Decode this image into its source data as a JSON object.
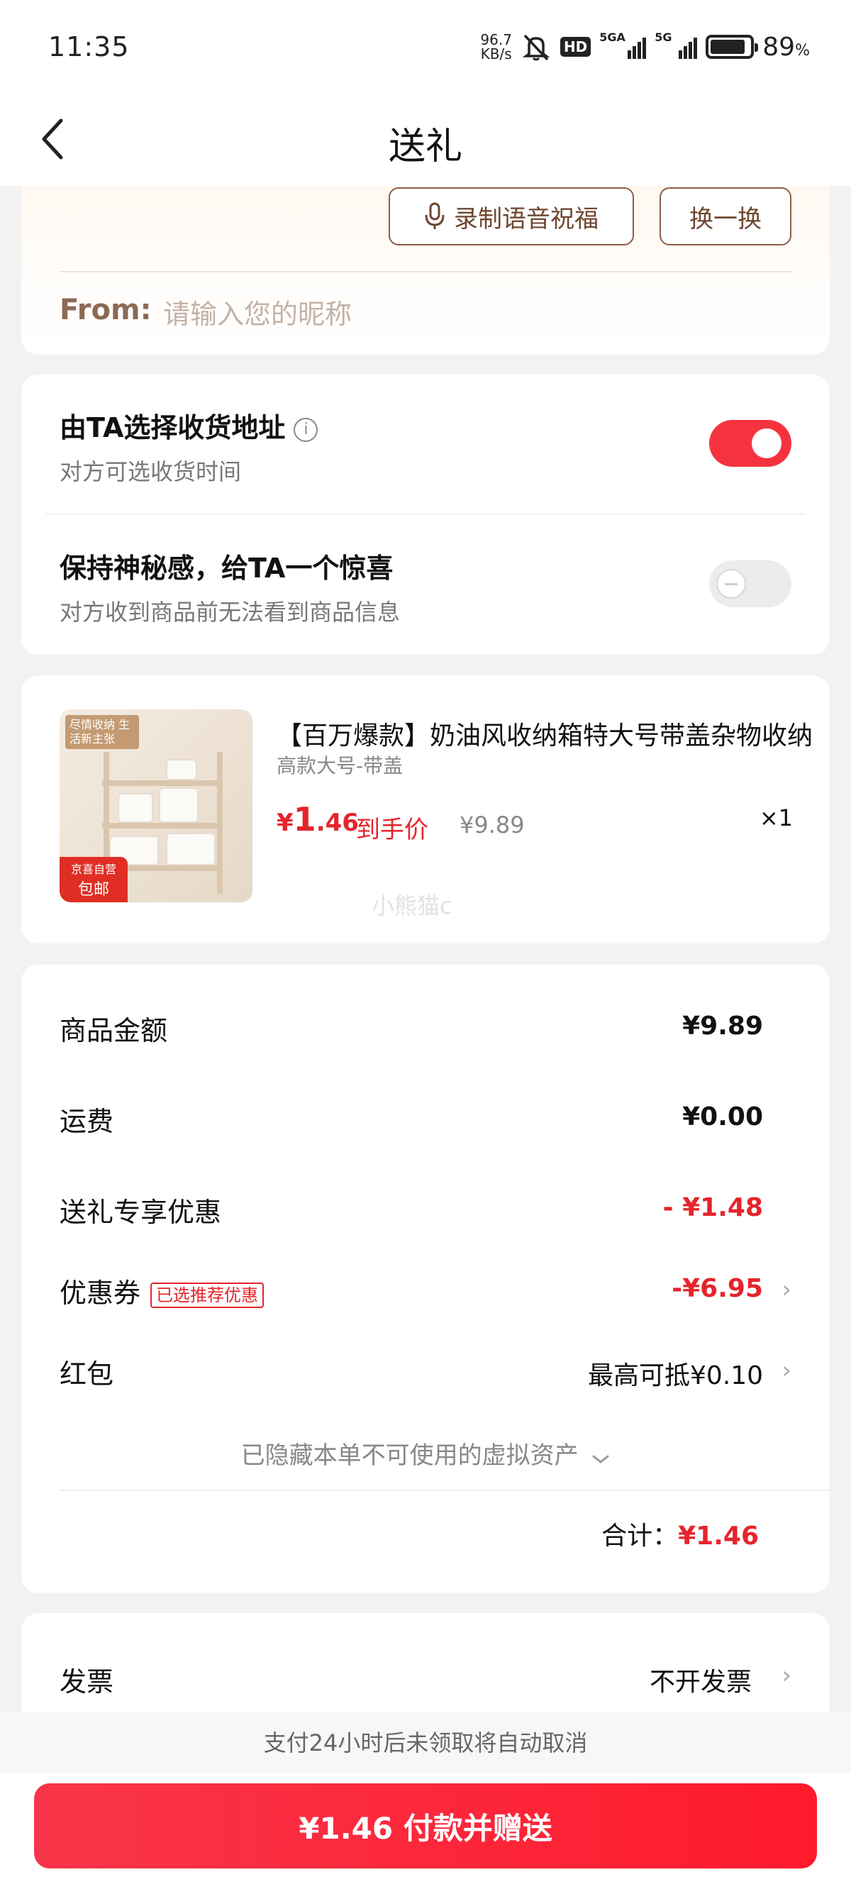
{
  "status_bar": {
    "time": "11:35",
    "net_speed_value": "96.7",
    "net_speed_unit": "KB/s",
    "hd_label": "HD",
    "signal1_label": "5GA",
    "signal2_label": "5G",
    "battery_percent": "89",
    "battery_unit": "%"
  },
  "nav": {
    "title": "送礼",
    "back_icon": "chevron-left-icon"
  },
  "greeting": {
    "record_button_label": "录制语音祝福",
    "swap_button_label": "换一换",
    "from_label": "From:",
    "from_placeholder": "请输入您的昵称"
  },
  "options": {
    "address": {
      "title": "由TA选择收货地址",
      "info": "i",
      "subtitle": "对方可选收货时间",
      "enabled": true
    },
    "mystery": {
      "title": "保持神秘感，给TA一个惊喜",
      "subtitle": "对方收到商品前无法看到商品信息",
      "enabled": false
    }
  },
  "product": {
    "title": "【百万爆款】奶油风收纳箱特大号带盖杂物收纳",
    "spec": "高款大号-带盖",
    "price_symbol": "¥",
    "price_int": "1",
    "price_dec": ".46",
    "price_label": "到手价",
    "original_price": "¥9.89",
    "quantity": "×1",
    "image_tag": "尽情收纳 生活新主张",
    "self_tag_line1": "京喜自营",
    "self_tag_line2": "包邮",
    "watermark": "小熊猫c"
  },
  "summary": {
    "items_label": "商品金额",
    "items_value": "¥9.89",
    "shipping_label": "运费",
    "shipping_value": "¥0.00",
    "gift_discount_label": "送礼专享优惠",
    "gift_discount_value": "- ¥1.48",
    "coupon_label": "优惠券",
    "coupon_badge": "已选推荐优惠",
    "coupon_value": "-¥6.95",
    "redpacket_label": "红包",
    "redpacket_value": "最高可抵¥0.10",
    "hidden_note": "已隐藏本单不可使用的虚拟资产",
    "total_label": "合计：",
    "total_value": "¥1.46"
  },
  "invoice": {
    "label": "发票",
    "value": "不开发票"
  },
  "bottom": {
    "cancel_note": "支付24小时后未领取将自动取消",
    "pay_button": "¥1.46 付款并赠送"
  },
  "colors": {
    "accent_red": "#e5242c",
    "button_red": "#f9354a",
    "brown": "#8b5e44"
  }
}
